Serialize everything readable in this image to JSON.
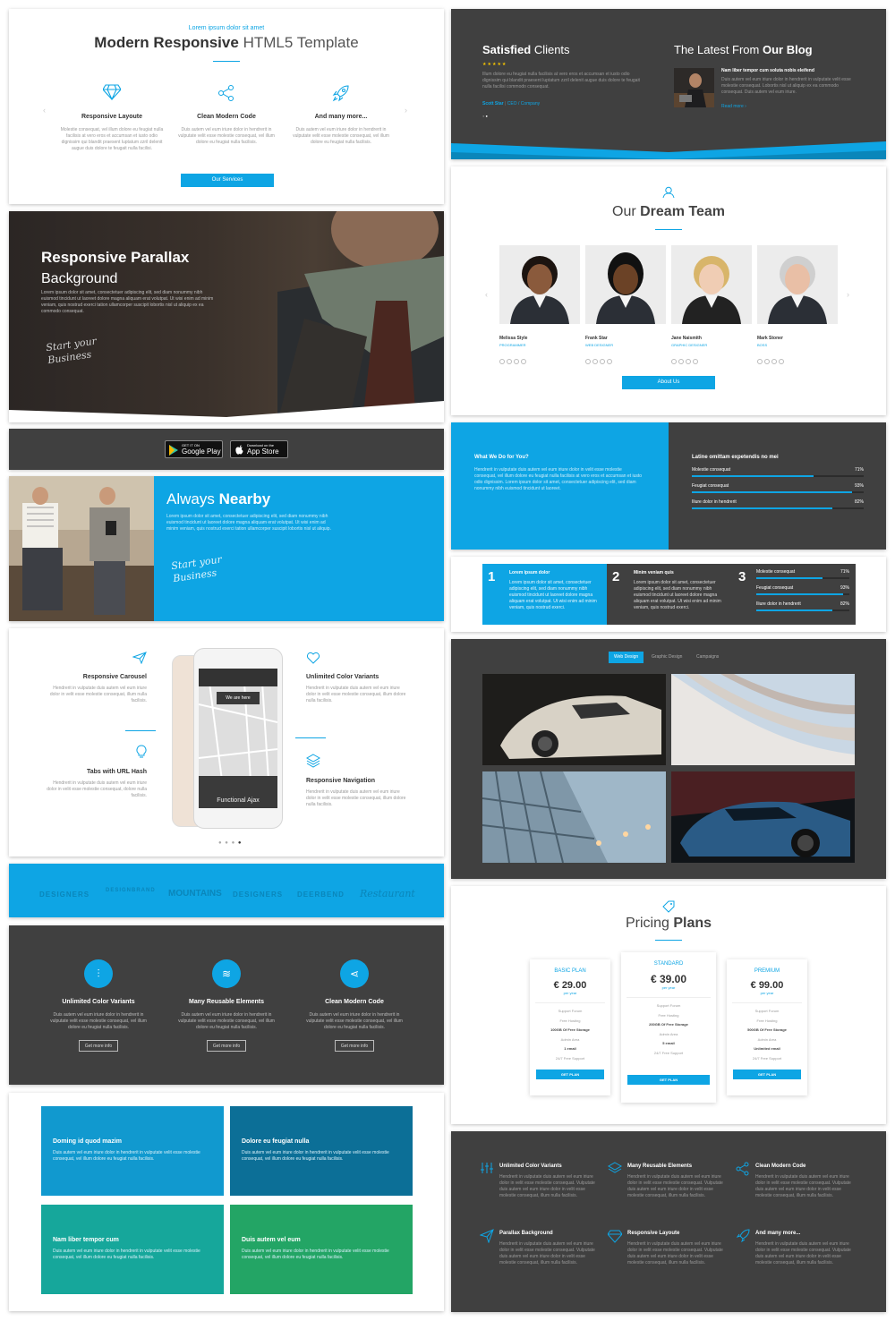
{
  "hero": {
    "kicker": "Lorem ipsum dolor sit amet",
    "title_bold": "Modern Responsive",
    "title_light": "HTML5 Template",
    "features": [
      {
        "icon": "diamond-icon",
        "title": "Responsive Layoute",
        "text": "Molestie consequat, vel illum dolore eu feugiat nulla facilisis at vero eros et accumsan et iusto odio dignissim qui blandit praesent luptatum zzril delenit augue duis dolore te feugait nulla facilisi."
      },
      {
        "icon": "share-icon",
        "title": "Clean Modern Code",
        "text": "Duis autem vel eum iriure dolor in hendrerit in vulputate velit esse molestie consequat, vel illum dolore eu feugiat nulla facilisis."
      },
      {
        "icon": "rocket-icon",
        "title": "And many more...",
        "text": "Duis autem vel eum iriure dolor in hendrerit in vulputate velit esse molestie consequat, vel illum dolore eu feugiat nulla facilisis."
      }
    ],
    "button": "Our Services"
  },
  "parallax": {
    "title_bold": "Responsive Parallax",
    "title_light": "Background",
    "text": "Lorem ipsum dolor sit amet, consectetuer adipiscing elit, sed diam nonummy nibh euismod tincidunt ut laoreet dolore magna aliquam erat volutpat. Ut wisi enim ad minim veniam, quis nostrud exerci tation ullamcorper suscipit lobortis nisl ut aliquip ex ea commodo consequat.",
    "signature": "Start your Business"
  },
  "apps": {
    "google_small": "GET IT ON",
    "google_big": "Google Play",
    "apple_small": "Download on the",
    "apple_big": "App Store"
  },
  "nearby": {
    "title_light": "Always",
    "title_bold": "Nearby",
    "text": "Lorem ipsum dolor sit amet, consectetuer adipiscing elit, sed diam nonummy nibh euismod tincidunt ut laoreet dolore magna aliquam erat volutpat. Ut wisi enim ad minim veniam, quis nostrud exerci tation ullamcorper suscipit lobortis nisl ut aliquip.",
    "signature": "Start your Business"
  },
  "phone_features": {
    "left": [
      {
        "icon": "paper-plane-icon",
        "title": "Responsive Carousel",
        "text": "Hendrerit in vulputate duis autem vel eum iriure dolor in velit esse molestie consequat, illum nulla facilisis."
      },
      {
        "icon": "lightbulb-icon",
        "title": "Tabs with URL Hash",
        "text": "Hendrerit in vulputate duis autem vel eum iriure dolor in velit esse molestie consequat, dolore nulla facilisis."
      }
    ],
    "right": [
      {
        "icon": "heart-icon",
        "title": "Unlimited Color Variants",
        "text": "Hendrerit in vulputate duis autem vel eum iriure dolor in velit esse molestie consequat, illum dolore nulla facilisis."
      },
      {
        "icon": "layers-icon",
        "title": "Responsive Navigation",
        "text": "Hendrerit in vulputate duis autem vel eum iriure dolor in velit esse molestie consequat, illum dolore nulla facilisis."
      }
    ],
    "screen_label": "We are here",
    "screen_caption": "Functional Ajax"
  },
  "logos": [
    "DESIGNERS",
    "DESIGNBRAND",
    "MOUNTAINS",
    "DESIGNERS",
    "DEERBEND",
    "Restaurant"
  ],
  "dark_features": {
    "items": [
      {
        "icon": "sliders-icon",
        "title": "Unlimited Color Variants",
        "text": "Duis autem vel eum iriure dolor in hendrerit in vulputate velit esse molestie consequat, vel illum dolore eu feugiat nulla facilisis.",
        "button": "Get more info"
      },
      {
        "icon": "layers-icon",
        "title": "Many Reusable Elements",
        "text": "Duis autem vel eum iriure dolor in hendrerit in vulputate velit esse molestie consequat, vel illum dolore eu feugiat nulla facilisis.",
        "button": "Get more info"
      },
      {
        "icon": "share-icon",
        "title": "Clean Modern Code",
        "text": "Duis autem vel eum iriure dolor in hendrerit in vulputate velit esse molestie consequat, vel illum dolore eu feugiat nulla facilisis.",
        "button": "Get more info"
      }
    ]
  },
  "tiles": [
    {
      "title": "Doming id quod mazim",
      "text": "Duis autem vel eum iriure dolor in hendrerit in vulputate velit esse molestie consequat, vel illum dolore eu feugiat nulla facilisis.",
      "color": "#1199cf"
    },
    {
      "title": "Dolore eu feugiat nulla",
      "text": "Duis autem vel eum iriure dolor in hendrerit in vulputate velit esse molestie consequat, vel illum dolore eu feugiat nulla facilisis.",
      "color": "#0c6f97"
    },
    {
      "title": "Nam liber tempor cum",
      "text": "Duis autem vel eum iriure dolor in hendrerit in vulputate velit esse molestie consequat, vel illum dolore eu feugiat nulla facilisis.",
      "color": "#16a79b"
    },
    {
      "title": "Duis autem vel eum",
      "text": "Duis autem vel eum iriure dolor in hendrerit in vulputate velit esse molestie consequat, vel illum dolore eu feugiat nulla facilisis.",
      "color": "#23a565"
    }
  ],
  "clients": {
    "title_bold": "Satisfied",
    "title_light": "Clients",
    "stars": "★★★★★",
    "text": "Illum dolore eu feugiat nulla facilisis at vero eros et accumsan et iusto odio dignissim qui blandit praesent luptatum zzril delenit augue duis dolore te feugait nulla facilisi commodo consequat.",
    "author": "Scott Star",
    "company": "CEO / Company"
  },
  "blog": {
    "title_light": "The Latest From",
    "title_bold": "Our Blog",
    "post_title": "Nam liber tempor cum soluta nobis eleifend",
    "post_text": "Duis autem vel eum iriure dolor in hendrerit in vulputate velit esse molestie consequat. Lobortis nisl ut aliquip ex ea commodo consequat. Duis autem vel eum iriure.",
    "read_more": "Read more ›"
  },
  "team": {
    "title_light": "Our",
    "title_bold": "Dream Team",
    "members": [
      {
        "name": "Melissa Style",
        "role": "PROGRAMMER",
        "skin": "#8a5a3c",
        "hair": "#1c1410"
      },
      {
        "name": "Frank Star",
        "role": "WEB DESIGNER",
        "skin": "#6b4226",
        "hair": "#111111"
      },
      {
        "name": "Jane Naismith",
        "role": "GRAPHIC DESIGNER",
        "skin": "#f0cdb4",
        "hair": "#d8b56a"
      },
      {
        "name": "Mark Stoner",
        "role": "BOSS",
        "skin": "#e9bfa6",
        "hair": "#cfcfcf"
      }
    ],
    "button": "About Us"
  },
  "whatwedo": {
    "title": "What We Do for You?",
    "text": "Hendrerit in vulputate duis autem vel eum iriure dolor in velit esse molestie consequat, vel illum dolore eu feugiat nulla facilisis at vero eros et accumsan et iusto odio dignissim. Lorem ipsum dolor sit amet, consectetuer adipiscing elit, sed diam nonummy nibh euismod tincidunt ut laoreet.",
    "skills_title": "Latine omittam expetendis no mei",
    "skills": [
      {
        "label": "Molestie consequat",
        "percent": 71
      },
      {
        "label": "Feugiat consequat",
        "percent": 93
      },
      {
        "label": "Iliure dolor in hendrerit",
        "percent": 82
      }
    ]
  },
  "steps": {
    "items": [
      {
        "num": "1",
        "title": "Lorem ipsum dolor",
        "text": "Lorem ipsum dolor sit amet, consectetuer adipiscing elit, sed diam nonummy nibh euismod tincidunt ut laoreet dolore magna aliquam erat volutpat. Ut wisi enim ad minim veniam, quis nostrud exerci."
      },
      {
        "num": "2",
        "title": "Minim veniam quis",
        "text": "Lorem ipsum dolor sit amet, consectetuer adipiscing elit, sed diam nonummy nibh euismod tincidunt ut laoreet dolore magna aliquam erat volutpat. Ut wisi enim ad minim veniam, quis nostrud exerci."
      }
    ],
    "num3": "3",
    "skills": [
      {
        "label": "Molestie consequat",
        "percent": 71
      },
      {
        "label": "Feugiat consequat",
        "percent": 93
      },
      {
        "label": "Iliure dolor in hendrerit",
        "percent": 82
      }
    ]
  },
  "portfolio": {
    "tabs": [
      "Web Design",
      "Graphic Design",
      "Campaigns"
    ]
  },
  "pricing": {
    "title_light": "Pricing",
    "title_bold": "Plans",
    "plans": [
      {
        "name": "BASIC PLAN",
        "price": "€ 29.00",
        "period": "per year",
        "features": [
          "Support Forum",
          "Free Hosting",
          "100GB Of Free Storage",
          "Admin Area",
          "1 email",
          "24/7 Free Support"
        ],
        "button": "GET PLAN"
      },
      {
        "name": "STANDARD",
        "price": "€ 39.00",
        "period": "per year",
        "features": [
          "Support Forum",
          "Free Hosting",
          "200GB Of Free Storage",
          "Admin Area",
          "5 email",
          "24/7 Free Support"
        ],
        "button": "GET PLAN"
      },
      {
        "name": "PREMIUM",
        "price": "€ 99.00",
        "period": "per year",
        "features": [
          "Support Forum",
          "Free Hosting",
          "500GB Of Free Storage",
          "Admin Area",
          "Unlimited email",
          "24/7 Free Support"
        ],
        "button": "GET PLAN"
      }
    ]
  },
  "features_grid": [
    {
      "icon": "sliders-icon",
      "title": "Unlimited Color Variants",
      "text": "Hendrerit in vulputate duis autem vel eum iriure dolor in velit esse molestie consequat. Vulputate duis autem vel eum iriure dolor in velit esse molestie consequat, illum nulla facilisis."
    },
    {
      "icon": "layers-icon",
      "title": "Many Reusable Elements",
      "text": "Hendrerit in vulputate duis autem vel eum iriure dolor in velit esse molestie consequat. Vulputate duis autem vel eum iriure dolor in velit esse molestie consequat, illum nulla facilisis."
    },
    {
      "icon": "share-icon",
      "title": "Clean Modern Code",
      "text": "Hendrerit in vulputate duis autem vel eum iriure dolor in velit esse molestie consequat. Vulputate duis autem vel eum iriure dolor in velit esse molestie consequat, illum nulla facilisis."
    },
    {
      "icon": "paper-plane-icon",
      "title": "Parallax Background",
      "text": "Hendrerit in vulputate duis autem vel eum iriure dolor in velit esse molestie consequat. Vulputate duis autem vel eum iriure dolor in velit esse molestie consequat, illum nulla facilisis."
    },
    {
      "icon": "diamond-icon",
      "title": "Responsive Layoute",
      "text": "Hendrerit in vulputate duis autem vel eum iriure dolor in velit esse molestie consequat. Vulputate duis autem vel eum iriure dolor in velit esse molestie consequat, illum nulla facilisis."
    },
    {
      "icon": "rocket-icon",
      "title": "And many more...",
      "text": "Hendrerit in vulputate duis autem vel eum iriure dolor in velit esse molestie consequat. Vulputate duis autem vel eum iriure dolor in velit esse molestie consequat, illum nulla facilisis."
    }
  ],
  "colors": {
    "accent": "#0ea5e4",
    "dark": "#404040"
  }
}
